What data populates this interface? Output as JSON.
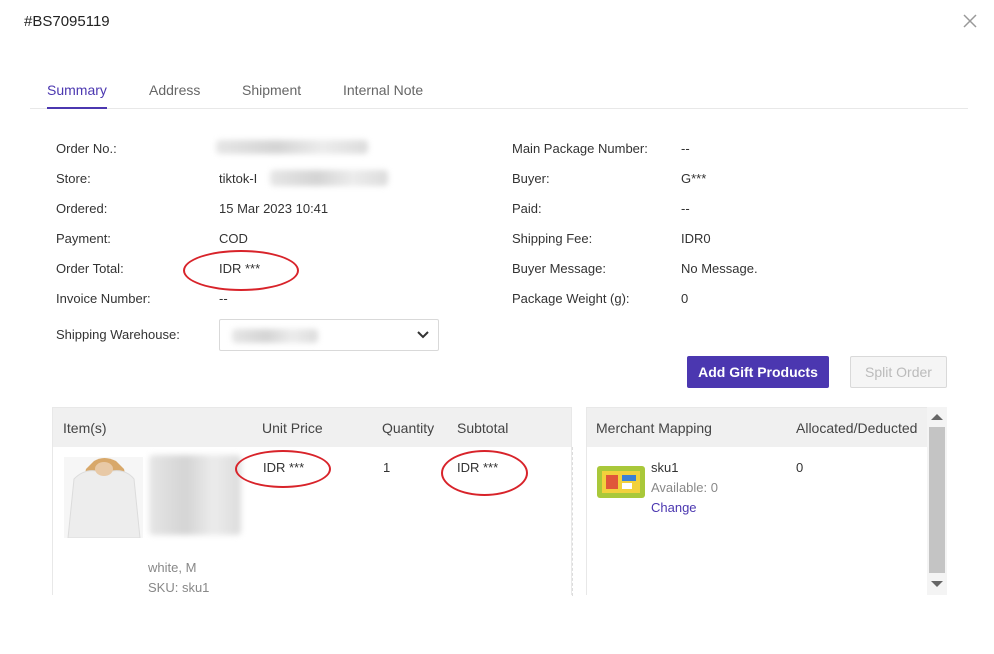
{
  "header": {
    "title": "#BS7095119",
    "close_icon": "close-icon"
  },
  "tabs": [
    {
      "label": "Summary",
      "active": true
    },
    {
      "label": "Address",
      "active": false
    },
    {
      "label": "Shipment",
      "active": false
    },
    {
      "label": "Internal Note",
      "active": false
    }
  ],
  "summary": {
    "left": [
      {
        "label": "Order No.:",
        "value": ""
      },
      {
        "label": "Store:",
        "value": "tiktok-I"
      },
      {
        "label": "Ordered:",
        "value": "15 Mar 2023 10:41"
      },
      {
        "label": "Payment:",
        "value": "COD"
      },
      {
        "label": "Order Total:",
        "value": "IDR ***"
      },
      {
        "label": "Invoice Number:",
        "value": "--"
      }
    ],
    "right": [
      {
        "label": "Main Package Number:",
        "value": "--"
      },
      {
        "label": "Buyer:",
        "value": "G***"
      },
      {
        "label": "Paid:",
        "value": "--"
      },
      {
        "label": "Shipping Fee:",
        "value": "IDR0"
      },
      {
        "label": "Buyer Message:",
        "value": "No Message."
      },
      {
        "label": "Package Weight (g):",
        "value": "0"
      }
    ],
    "shipping_warehouse": {
      "label": "Shipping Warehouse:",
      "value": ""
    }
  },
  "actions": {
    "add_gift": "Add Gift Products",
    "split_order": "Split Order"
  },
  "items_table": {
    "headers": [
      "Item(s)",
      "Unit Price",
      "Quantity",
      "Subtotal"
    ],
    "rows": [
      {
        "variant": "white, M",
        "sku": "SKU: sku1",
        "unit_price": "IDR ***",
        "quantity": "1",
        "subtotal": "IDR ***"
      }
    ]
  },
  "mapping_table": {
    "headers": [
      "Merchant Mapping",
      "Allocated/Deducted"
    ],
    "rows": [
      {
        "sku": "sku1",
        "available": "Available: 0",
        "change": "Change",
        "allocated": "0"
      }
    ]
  },
  "colors": {
    "accent": "#4b37b0",
    "annotation": "#d8232a"
  }
}
